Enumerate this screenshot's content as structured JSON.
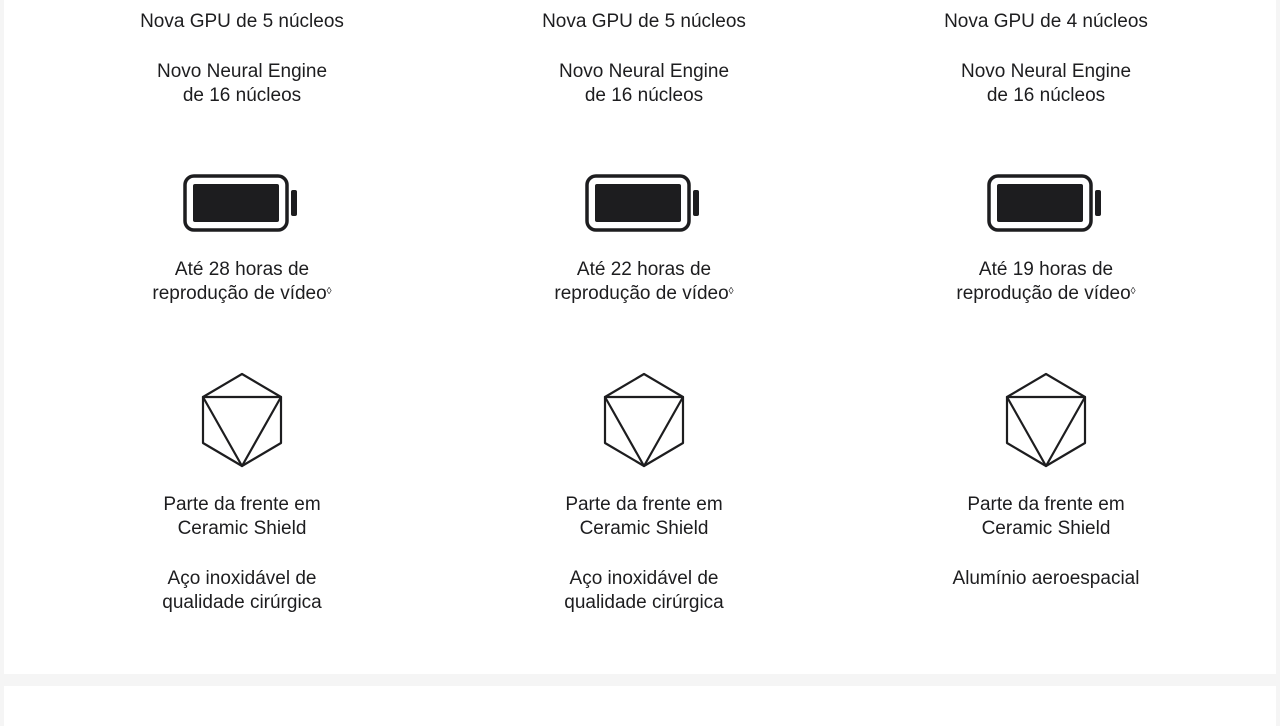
{
  "comparison": {
    "columns": [
      {
        "gpu": "Nova GPU de 5 núcleos",
        "neural_line1": "Novo Neural Engine",
        "neural_line2": "de 16 núcleos",
        "battery_line1": "Até 28 horas de",
        "battery_line2": "reprodução de vídeo",
        "battery_footnote": "◊",
        "battery_icon": "battery-icon",
        "shield_icon": "ceramic-shield-icon",
        "front_line1": "Parte da frente em",
        "front_line2": "Ceramic Shield",
        "material_line1": "Aço inoxidável de",
        "material_line2": "qualidade cirúrgica"
      },
      {
        "gpu": "Nova GPU de 5 núcleos",
        "neural_line1": "Novo Neural Engine",
        "neural_line2": "de 16 núcleos",
        "battery_line1": "Até 22 horas de",
        "battery_line2": "reprodução de vídeo",
        "battery_footnote": "◊",
        "battery_icon": "battery-icon",
        "shield_icon": "ceramic-shield-icon",
        "front_line1": "Parte da frente em",
        "front_line2": "Ceramic Shield",
        "material_line1": "Aço inoxidável de",
        "material_line2": "qualidade cirúrgica"
      },
      {
        "gpu": "Nova GPU de 4 núcleos",
        "neural_line1": "Novo Neural Engine",
        "neural_line2": "de 16 núcleos",
        "battery_line1": "Até 19 horas de",
        "battery_line2": "reprodução de vídeo",
        "battery_footnote": "◊",
        "battery_icon": "battery-icon",
        "shield_icon": "ceramic-shield-icon",
        "front_line1": "Parte da frente em",
        "front_line2": "Ceramic Shield",
        "material_line1": "Alumínio aeroespacial",
        "material_line2": ""
      }
    ]
  },
  "colors": {
    "text": "#1d1d1f",
    "background": "#ffffff",
    "page": "#f5f5f5",
    "icon": "#1d1d1f"
  }
}
